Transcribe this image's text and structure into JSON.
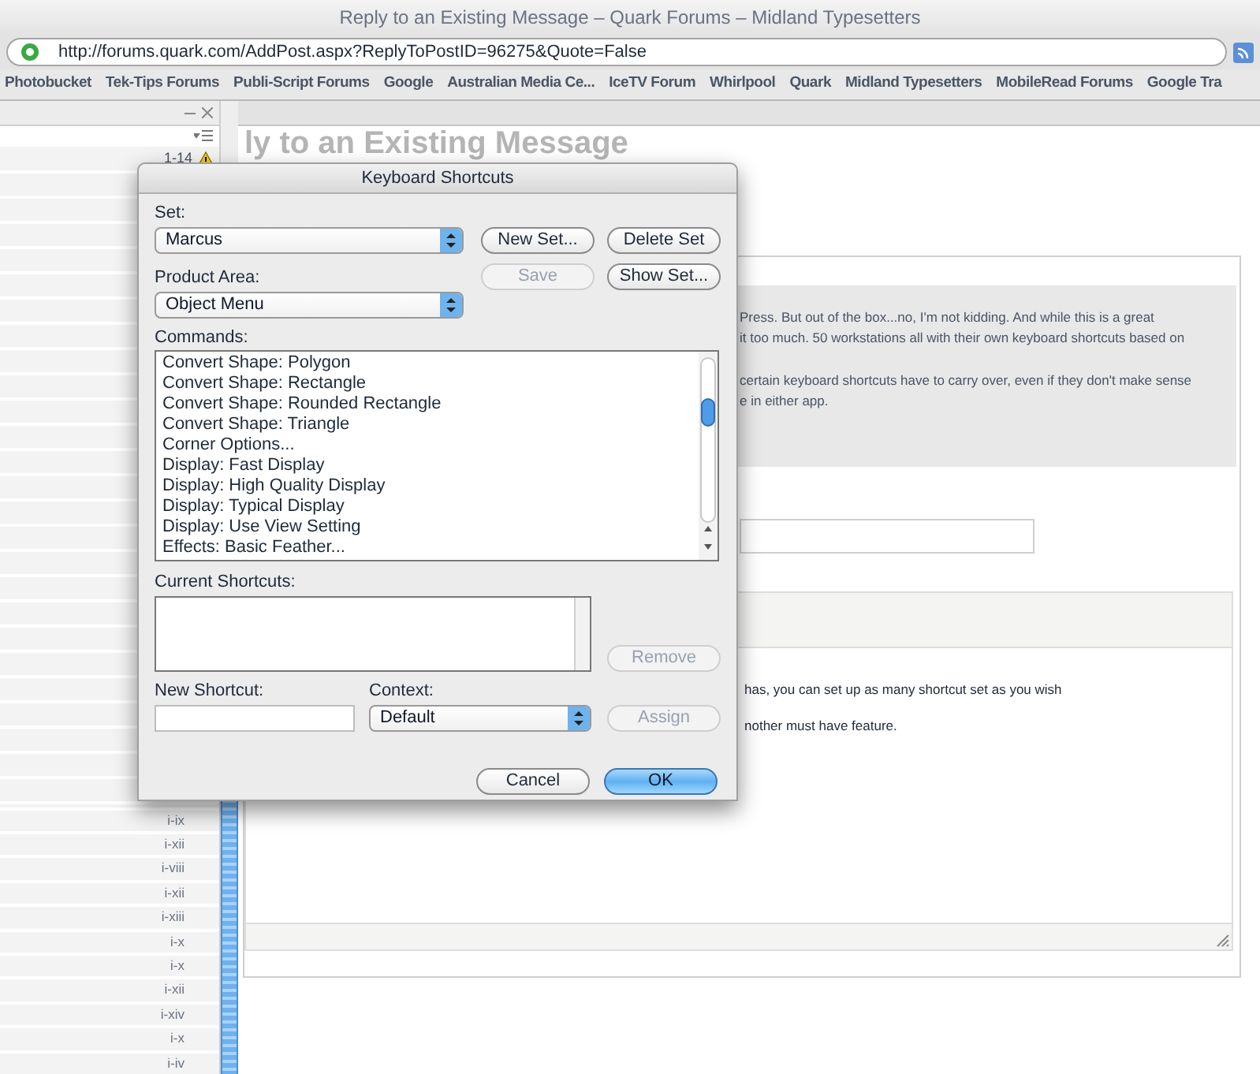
{
  "window": {
    "title": "Reply to an Existing Message – Quark Forums – Midland Typesetters"
  },
  "address_bar": {
    "url": "http://forums.quark.com/AddPost.aspx?ReplyToPostID=96275&Quote=False"
  },
  "bookmarks": [
    "Photobucket",
    "Tek-Tips Forums",
    "Publi-Script Forums",
    "Google",
    "Australian Media Ce...",
    "IceTV Forum",
    "Whirlpool",
    "Quark",
    "Midland Typesetters",
    "MobileRead Forums",
    "Google Tra"
  ],
  "sidebar": {
    "count": "1-14",
    "items": [
      "i-ix",
      "i-xii",
      "i-viii",
      "i-xii",
      "i-xiii",
      "i-x",
      "i-x",
      "i-xii",
      "i-xiv",
      "i-x",
      "i-iv"
    ]
  },
  "page": {
    "heading": "ly to an Existing Message",
    "quote_paragraphs": [
      [
        "Press. But out of the box...no, I'm not kidding. And while this is a great",
        "it too much. 50 workstations all with their own keyboard shortcuts based on"
      ],
      [
        "certain keyboard shortcuts have to carry over, even if they don't make sense",
        "e in either app."
      ]
    ],
    "body_lines": [
      "has, you can set up as many shortcut set as you wish",
      "nother must have feature."
    ]
  },
  "dialog": {
    "title": "Keyboard Shortcuts",
    "set": {
      "label": "Set:",
      "value": "Marcus"
    },
    "set_buttons": [
      {
        "label": "New Set...",
        "disabled": false
      },
      {
        "label": "Delete Set",
        "disabled": false
      }
    ],
    "product_area": {
      "label": "Product Area:",
      "value": "Object Menu"
    },
    "area_buttons": [
      {
        "label": "Save",
        "disabled": true
      },
      {
        "label": "Show Set...",
        "disabled": false
      }
    ],
    "commands": {
      "label": "Commands:",
      "items": [
        "Convert Shape: Polygon",
        "Convert Shape: Rectangle",
        "Convert Shape: Rounded Rectangle",
        "Convert Shape: Triangle",
        "Corner Options...",
        "Display: Fast Display",
        "Display: High Quality Display",
        "Display: Typical Display",
        "Display: Use View Setting",
        "Effects: Basic Feather..."
      ]
    },
    "current_shortcuts": {
      "label": "Current Shortcuts:"
    },
    "remove_button": {
      "label": "Remove",
      "disabled": true
    },
    "new_shortcut": {
      "label": "New Shortcut:"
    },
    "context": {
      "label": "Context:",
      "value": "Default"
    },
    "assign_button": {
      "label": "Assign",
      "disabled": true
    },
    "footer_buttons": [
      {
        "label": "Cancel",
        "primary": false
      },
      {
        "label": "OK",
        "primary": true
      }
    ]
  }
}
